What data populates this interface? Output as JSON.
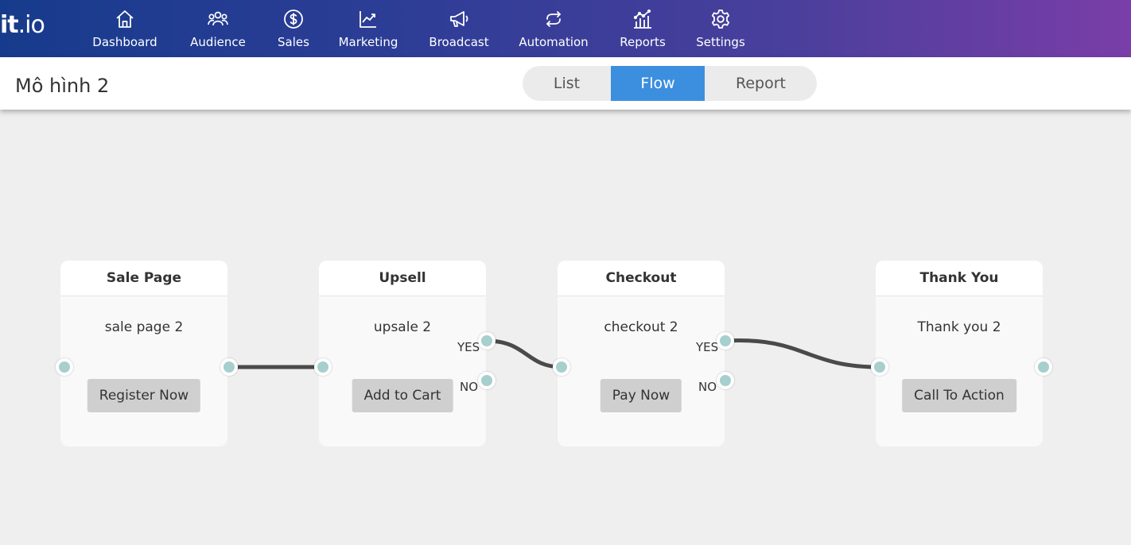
{
  "brand": {
    "logo_bold": "it",
    "logo_rest": ".io"
  },
  "nav": [
    {
      "label": "Dashboard",
      "icon": "home-icon"
    },
    {
      "label": "Audience",
      "icon": "users-icon"
    },
    {
      "label": "Sales",
      "icon": "dollar-icon"
    },
    {
      "label": "Marketing",
      "icon": "trend-chart-icon"
    },
    {
      "label": "Broadcast",
      "icon": "megaphone-icon"
    },
    {
      "label": "Automation",
      "icon": "repeat-icon"
    },
    {
      "label": "Reports",
      "icon": "bar-chart-icon"
    },
    {
      "label": "Settings",
      "icon": "gear-icon"
    }
  ],
  "header": {
    "title": "Mô hình 2",
    "tabs": [
      {
        "label": "List",
        "active": false
      },
      {
        "label": "Flow",
        "active": true
      },
      {
        "label": "Report",
        "active": false
      }
    ]
  },
  "flow": {
    "nodes": [
      {
        "title": "Sale Page",
        "subtitle": "sale page 2",
        "button": "Register Now"
      },
      {
        "title": "Upsell",
        "subtitle": "upsale 2",
        "button": "Add to Cart",
        "yes_label": "YES",
        "no_label": "NO"
      },
      {
        "title": "Checkout",
        "subtitle": "checkout 2",
        "button": "Pay Now",
        "yes_label": "YES",
        "no_label": "NO"
      },
      {
        "title": "Thank You",
        "subtitle": "Thank you 2",
        "button": "Call To Action"
      }
    ]
  },
  "colors": {
    "nav_gradient_start": "#173b8c",
    "nav_gradient_end": "#7a3ea8",
    "active_tab": "#3c8fde",
    "port": "#a6cfcd",
    "connector": "#4a4a4a",
    "canvas_bg": "#efefef"
  }
}
